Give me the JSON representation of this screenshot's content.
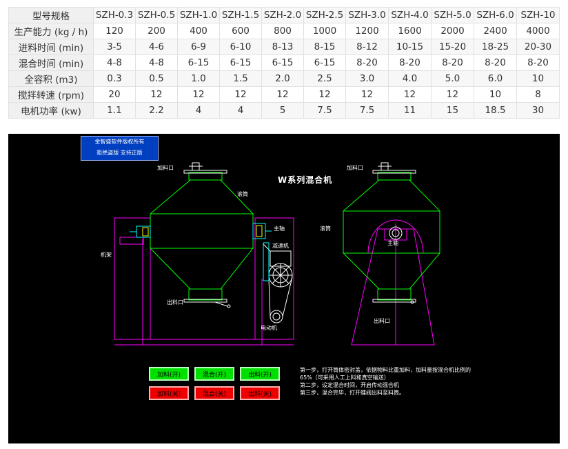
{
  "spec_table": {
    "header": [
      "型号规格",
      "SZH-0.3",
      "SZH-0.5",
      "SZH-1.0",
      "SZH-1.5",
      "SZH-2.0",
      "SZH-2.5",
      "SZH-3.0",
      "SZH-4.0",
      "SZH-5.0",
      "SZH-6.0",
      "SZH-10"
    ],
    "rows": [
      {
        "label": "生产能力 (kg / h)",
        "values": [
          "120",
          "200",
          "400",
          "600",
          "800",
          "1000",
          "1200",
          "1600",
          "2000",
          "2400",
          "4000"
        ]
      },
      {
        "label": "进料时间 (min)",
        "values": [
          "3-5",
          "4-6",
          "6-9",
          "6-10",
          "8-13",
          "8-15",
          "8-12",
          "10-15",
          "15-20",
          "18-25",
          "20-30"
        ]
      },
      {
        "label": "混合时间 (min)",
        "values": [
          "4-8",
          "4-8",
          "6-15",
          "6-15",
          "6-15",
          "6-15",
          "8-20",
          "8-20",
          "8-20",
          "8-20",
          "8-20"
        ]
      },
      {
        "label": "全容积 (m3)",
        "values": [
          "0.3",
          "0.5",
          "1.0",
          "1.5",
          "2.0",
          "2.5",
          "3.0",
          "4.0",
          "5.0",
          "6.0",
          "10"
        ]
      },
      {
        "label": "搅拌转速 (rpm)",
        "values": [
          "20",
          "12",
          "12",
          "12",
          "12",
          "12",
          "12",
          "12",
          "12",
          "10",
          "8"
        ]
      },
      {
        "label": "电机功率 (kw)",
        "values": [
          "1.1",
          "2.2",
          "4",
          "4",
          "5",
          "7.5",
          "7.5",
          "11",
          "15",
          "18.5",
          "30"
        ]
      }
    ]
  },
  "panel": {
    "notice_line1": "金智盛软件版权所有",
    "notice_line2": "拒绝盗版    支持正版",
    "title": "W系列混合机",
    "labels": {
      "inlet_left": "加料口",
      "inlet_right": "加料口",
      "drum_left": "滚筒",
      "drum_right": "滚筒",
      "frame": "机架",
      "shaft_left": "主轴",
      "shaft_right": "主轴",
      "reducer": "减速机",
      "motor": "电动机",
      "outlet_left": "出料口",
      "outlet_right": "出料口"
    },
    "buttons": {
      "feed_on": "加料(开)",
      "mix_on": "混合(开)",
      "discharge_on": "出料(开)",
      "feed_off": "加料(关)",
      "mix_off": "混合(关)",
      "discharge_off": "出料(关)"
    },
    "steps": {
      "step1": "第一步，打开筒体密封盖，依据物料比重加料，加料量按混合机比例的65%（可采用人工上料和真空输送）",
      "step2": "第二步，设定混合时间，开启传动混合机",
      "step3": "第三步，混合完毕，打开蝶阀出料至料筒。"
    },
    "colors": {
      "drum": "#00ff00",
      "frame": "#ff00ff",
      "shaft": "#00ffff",
      "on_button": "#00e000",
      "off_button": "#ee0000",
      "notice": "#003fbf"
    }
  }
}
